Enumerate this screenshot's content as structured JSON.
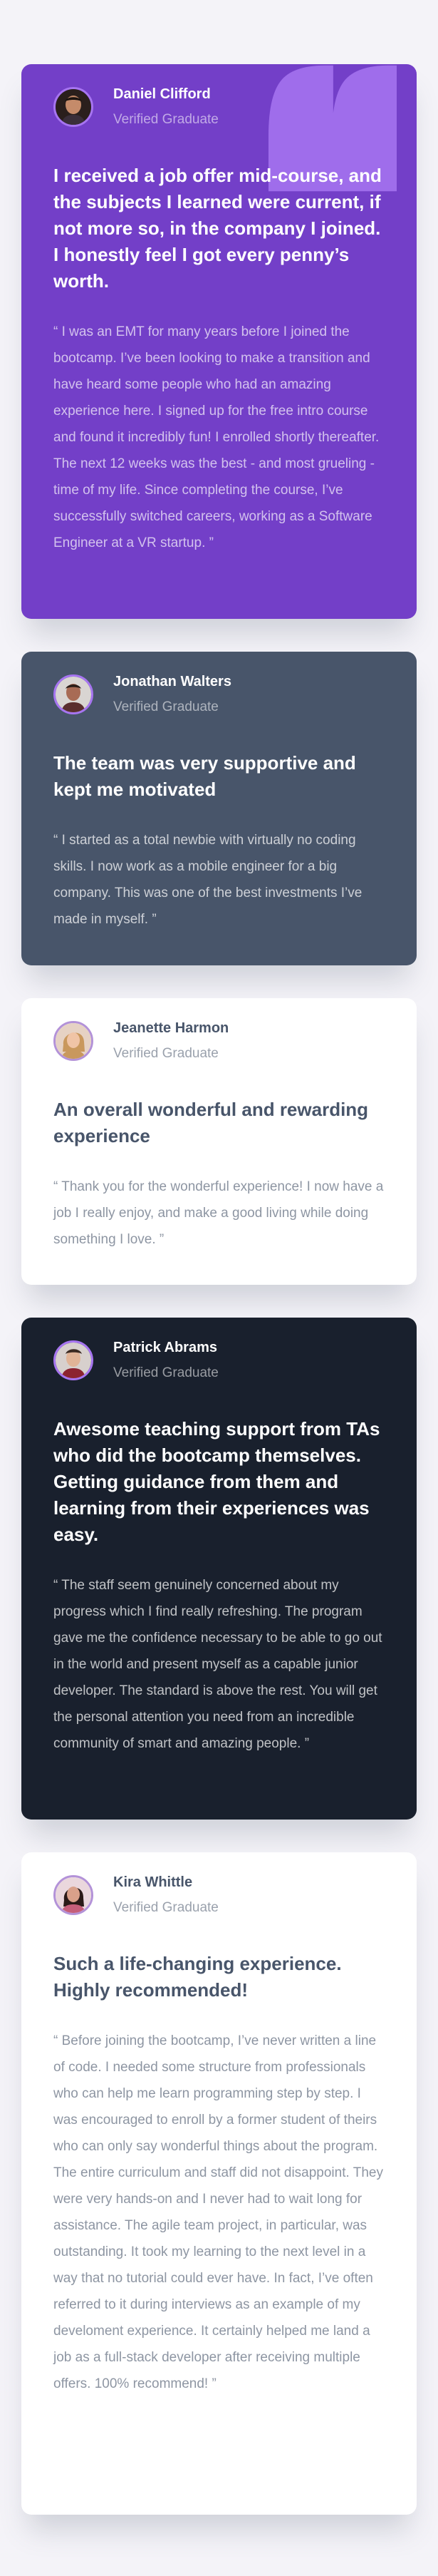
{
  "testimonials": [
    {
      "name": "Daniel Clifford",
      "status": "Verified Graduate",
      "headline": "I received a job offer mid-course, and the subjects I learned were current, if not more so, in the company I joined. I honestly feel I got every penny’s worth.",
      "body": "“ I was an EMT for many years before I joined the bootcamp. I’ve been looking to make a transition and have heard some people who had an amazing experience here. I signed up for the free intro course and found it incredibly fun! I enrolled shortly thereafter. The next 12 weeks was the best - and most grueling - time of my life. Since completing the course, I’ve successfully switched careers, working as a Software Engineer at a VR startup. ”",
      "background": "#733fc8"
    },
    {
      "name": "Jonathan Walters",
      "status": "Verified Graduate",
      "headline": "The team was very supportive and kept me motivated",
      "body": "“ I started as a total newbie with virtually no coding skills. I now work as a mobile engineer for a big company. This was one of the best investments I’ve made in myself. ”",
      "background": "#48556a"
    },
    {
      "name": "Jeanette Harmon",
      "status": "Verified Graduate",
      "headline": "An overall wonderful and rewarding experience",
      "body": "“ Thank you for the wonderful experience! I now have a job I really enjoy, and make a good living while doing something I love. ”",
      "background": "#ffffff"
    },
    {
      "name": "Patrick Abrams",
      "status": "Verified Graduate",
      "headline": "Awesome teaching support from TAs who did the bootcamp themselves. Getting guidance from them and learning from their experiences was easy.",
      "body": "“ The staff seem genuinely concerned about my progress which I find really refreshing. The program gave me the confidence necessary to be able to go out in the world and present myself as a capable junior developer. The standard is above the rest. You will get the personal attention you need from an incredible community of smart and amazing people. ”",
      "background": "#19202d"
    },
    {
      "name": "Kira Whittle",
      "status": "Verified Graduate",
      "headline": "Such a life-changing experience. Highly recommended!",
      "body": "“ Before joining the bootcamp, I’ve never written a line of code. I needed some structure from professionals who can help me learn programming step by step. I was encouraged to enroll by a former student of theirs who can only say wonderful things about the program. The entire curriculum and staff did not disappoint. They were very hands-on and I never had to wait long for assistance. The agile team project, in particular, was outstanding. It took my learning to the next level in a way that no tutorial could ever have. In fact, I’ve often referred to it during interviews as an example of my develoment experience. It certainly helped me land a job as a full-stack developer after receiving multiple offers. 100% recommend! ”",
      "background": "#ffffff"
    }
  ],
  "decor": {
    "quote_icon": "quotation-mark-icon",
    "quote_color": "#a775f1"
  }
}
